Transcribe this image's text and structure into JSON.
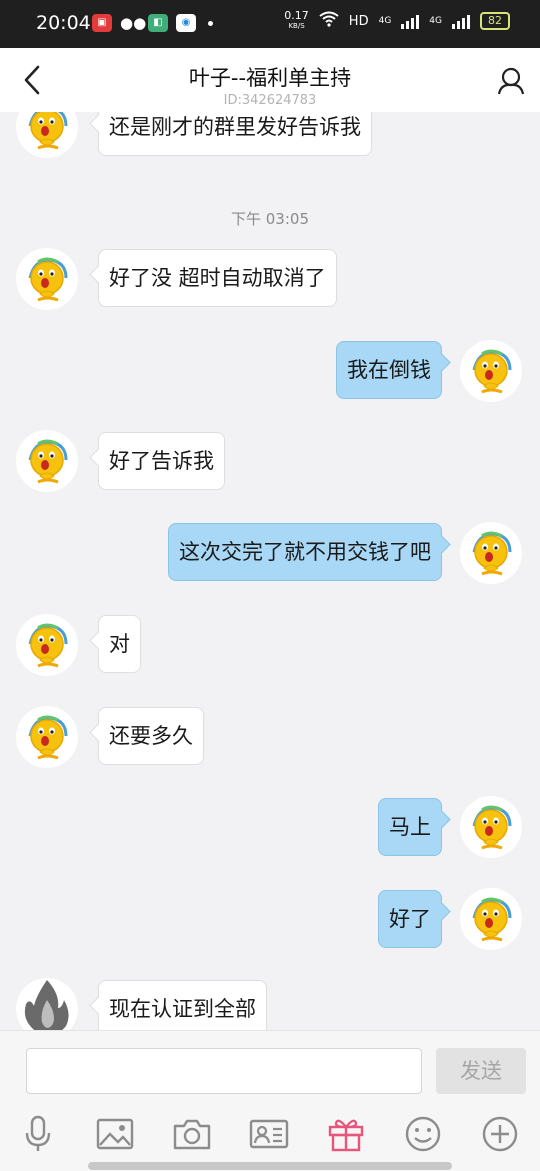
{
  "status_bar": {
    "time": "20:04",
    "speed": "0.17",
    "speed_unit": "KB/S",
    "network": "HD",
    "network2": "4G",
    "battery": "82"
  },
  "header": {
    "title": "叶子--福利单主持",
    "subtitle": "ID:342624783"
  },
  "chat": {
    "timestamp": "下午 03:05",
    "messages": [
      {
        "side": "left",
        "text": "还是刚才的群里发好告诉我"
      },
      {
        "side": "left",
        "text": "好了没 超时自动取消了"
      },
      {
        "side": "right",
        "text": "我在倒钱"
      },
      {
        "side": "left",
        "text": "好了告诉我"
      },
      {
        "side": "right",
        "text": "这次交完了就不用交钱了吧"
      },
      {
        "side": "left",
        "text": "对"
      },
      {
        "side": "left",
        "text": "还要多久"
      },
      {
        "side": "right",
        "text": "马上"
      },
      {
        "side": "right",
        "text": "好了"
      },
      {
        "side": "left",
        "text": "现在认证到全部"
      }
    ]
  },
  "input": {
    "placeholder": "",
    "send_label": "发送"
  },
  "toolbar": {
    "items": [
      "mic-icon",
      "image-icon",
      "camera-icon",
      "contact-card-icon",
      "gift-icon",
      "emoji-icon",
      "plus-icon"
    ],
    "gift_color": "#e8547a",
    "icon_color": "#8c8c8c"
  },
  "colors": {
    "bubble_right": "#a8d8f5",
    "bubble_left": "#ffffff",
    "background": "#f2f2f4"
  }
}
